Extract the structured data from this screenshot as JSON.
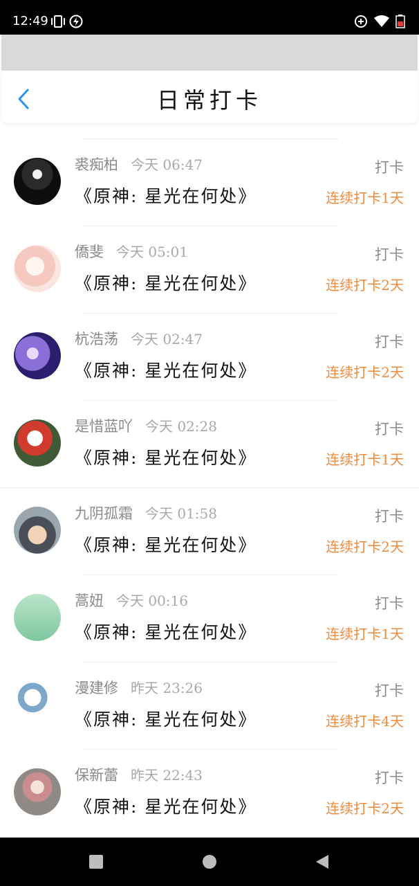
{
  "status": {
    "time": "12:49",
    "icons": [
      "vibrate-icon",
      "flash-icon",
      "data-saver-icon",
      "wifi-icon",
      "battery-icon"
    ]
  },
  "header": {
    "title": "日常打卡"
  },
  "entries": [
    {
      "name": "裘痴柏",
      "time": "今天 06:47",
      "book": "《原神: 星光在何处》",
      "action": "打卡",
      "streak": "连续打卡1天",
      "avatar": "avatar-dark-figure"
    },
    {
      "name": "僑斐",
      "time": "今天 05:01",
      "book": "《原神: 星光在何处》",
      "action": "打卡",
      "streak": "连续打卡2天",
      "avatar": "avatar-anime-girl"
    },
    {
      "name": "杭浩荡",
      "time": "今天 02:47",
      "book": "《原神: 星光在何处》",
      "action": "打卡",
      "streak": "连续打卡2天",
      "avatar": "avatar-purple-fantasy"
    },
    {
      "name": "是惜蓝吖",
      "time": "今天 02:28",
      "book": "《原神: 星光在何处》",
      "action": "打卡",
      "streak": "连续打卡1天",
      "avatar": "avatar-bunny-plush"
    },
    {
      "name": "九阴孤霜",
      "time": "今天 01:58",
      "book": "《原神: 星光在何处》",
      "action": "打卡",
      "streak": "连续打卡2天",
      "avatar": "avatar-child-cap"
    },
    {
      "name": "蒿妞",
      "time": "今天 00:16",
      "book": "《原神: 星光在何处》",
      "action": "打卡",
      "streak": "连续打卡1天",
      "avatar": "avatar-green-text"
    },
    {
      "name": "漫建修",
      "time": "昨天 23:26",
      "book": "《原神: 星光在何处》",
      "action": "打卡",
      "streak": "连续打卡4天",
      "avatar": "avatar-cartoon-character"
    },
    {
      "name": "保新蕾",
      "time": "昨天 22:43",
      "book": "《原神: 星光在何处》",
      "action": "打卡",
      "streak": "连续打卡2天",
      "avatar": "avatar-girl-pink"
    }
  ],
  "colors": {
    "accent": "#f08a3c",
    "back": "#2d8ff0",
    "muted": "#8a8a8a"
  }
}
